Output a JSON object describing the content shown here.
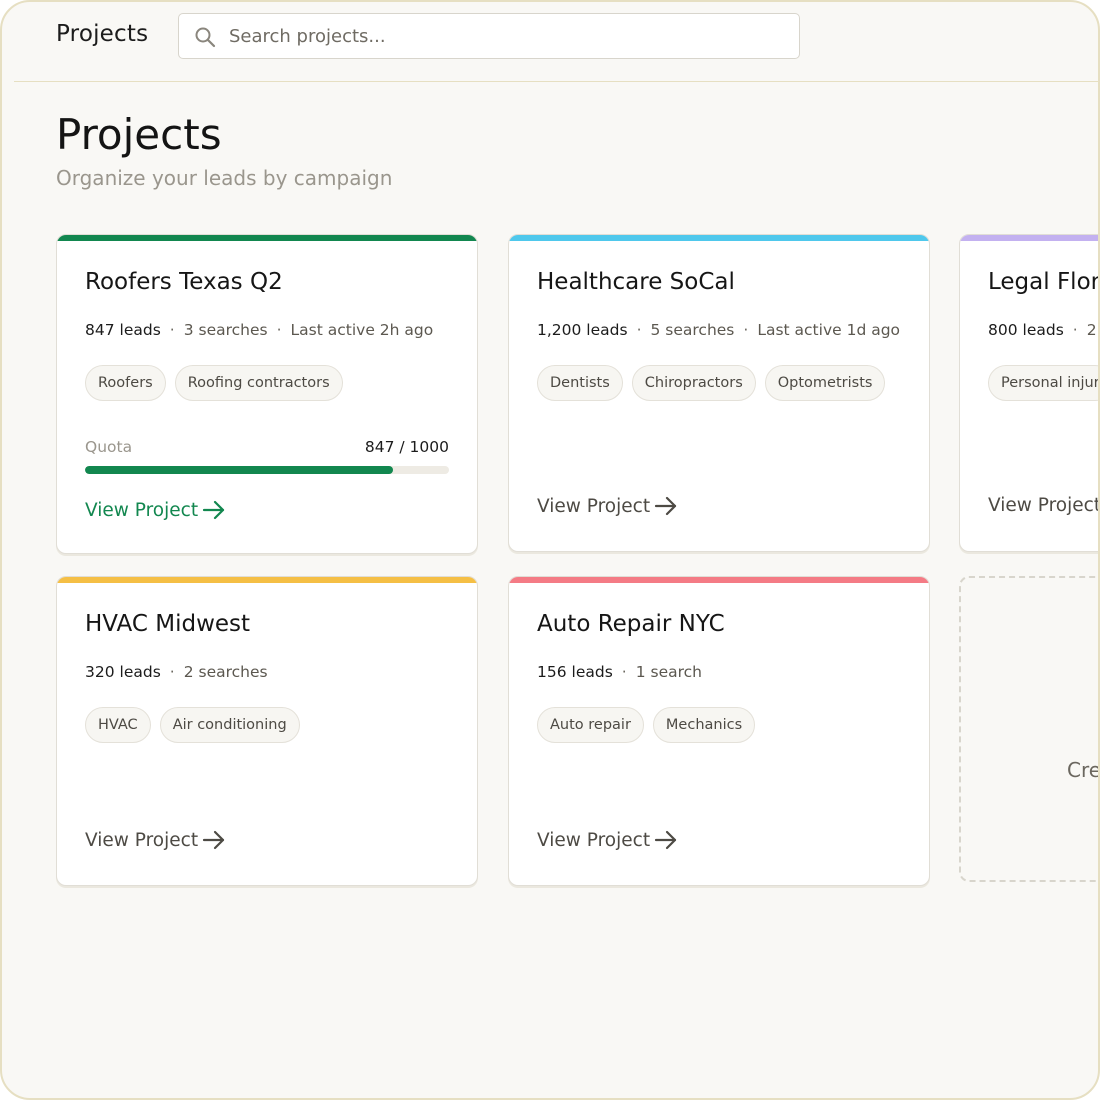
{
  "topbar": {
    "title": "Projects",
    "search_placeholder": "Search projects..."
  },
  "page": {
    "title": "Projects",
    "subtitle": "Organize your leads by campaign"
  },
  "projects": [
    {
      "title": "Roofers Texas Q2",
      "leads": "847 leads",
      "searches": "3 searches",
      "last_active": "Last active 2h ago",
      "tags": [
        "Roofers",
        "Roofing contractors"
      ],
      "accent": "#12874f",
      "quota_label": "Quota",
      "quota_value": "847 / 1000",
      "quota_fraction": 0.847,
      "view_label": "View Project"
    },
    {
      "title": "Healthcare SoCal",
      "leads": "1,200 leads",
      "searches": "5 searches",
      "last_active": "Last active 1d ago",
      "tags": [
        "Dentists",
        "Chiropractors",
        "Optometrists"
      ],
      "accent": "#4fc8ec",
      "view_label": "View Project"
    },
    {
      "title": "Legal Flor",
      "leads": "800 leads",
      "searches": "2",
      "tags": [
        "Personal injur"
      ],
      "accent": "#c3b1f0",
      "view_label": "View Project"
    },
    {
      "title": "HVAC Midwest",
      "leads": "320 leads",
      "searches": "2 searches",
      "tags": [
        "HVAC",
        "Air conditioning"
      ],
      "accent": "#f5bf45",
      "view_label": "View Project"
    },
    {
      "title": "Auto Repair NYC",
      "leads": "156 leads",
      "searches": "1 search",
      "tags": [
        "Auto repair",
        "Mechanics"
      ],
      "accent": "#f47b85",
      "view_label": "View Project"
    }
  ],
  "create": {
    "label": "Cre"
  },
  "colors": {
    "primary_green": "#12874f",
    "frame_border": "#e6dfc2",
    "background": "#f9f8f5"
  },
  "icons": {
    "search": "search-icon",
    "arrow": "arrow-right-icon"
  }
}
